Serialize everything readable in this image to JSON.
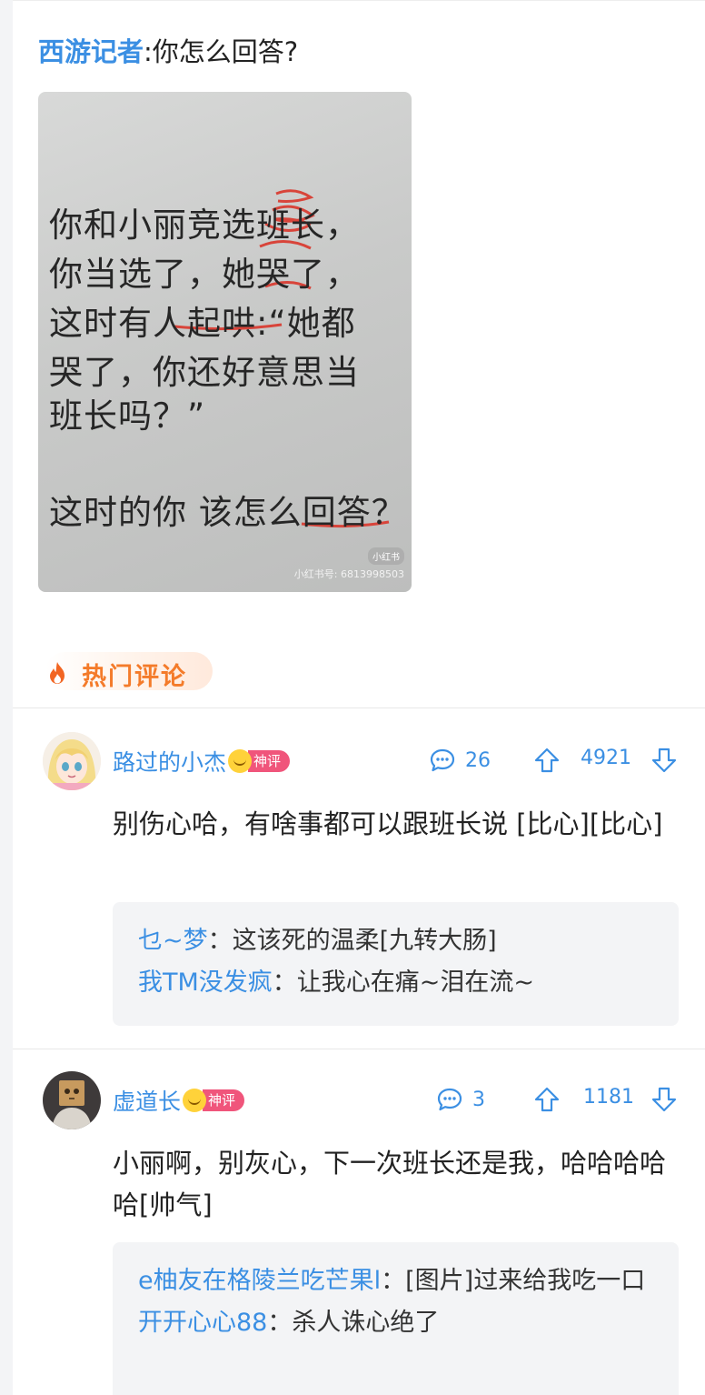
{
  "post": {
    "author": "西游记者",
    "separator": ":",
    "text": "你怎么回答?",
    "image": {
      "lines": [
        "你和小丽竞选班长，",
        "你当选了，她哭了，",
        "这时有人起哄:“她都",
        "哭了，你还好意思当",
        "班长吗？”",
        "这时的你 该怎么回答？"
      ],
      "logo": "小红书",
      "watermark": "小红书号: 6813998503"
    }
  },
  "hot_section": {
    "icon": "flame-icon",
    "label": "热门评论",
    "accent_color": "#f47b2a"
  },
  "comments": [
    {
      "username": "路过的小杰",
      "badge": "神评",
      "reply_count": "26",
      "upvotes": "4921",
      "text": "别伤心哈，有啥事都可以跟班长说 [比心][比心]",
      "replies": [
        {
          "user": "乜~梦",
          "sep": "：",
          "text": "这该死的温柔[九转大肠]"
        },
        {
          "user": "我TM没发疯",
          "sep": "：",
          "text": "让我心在痛~泪在流~"
        }
      ]
    },
    {
      "username": "虚道长",
      "badge": "神评",
      "reply_count": "3",
      "upvotes": "1181",
      "text": "小丽啊，别灰心，下一次班长还是我，哈哈哈哈哈[帅气]",
      "replies": [
        {
          "user": "e柚友在格陵兰吃芒果l",
          "sep": "：",
          "text": "[图片]过来给我吃一口"
        },
        {
          "user": "开开心心88",
          "sep": "：",
          "text": "杀人诛心绝了"
        }
      ]
    }
  ],
  "colors": {
    "link": "#3b8fe3",
    "badge": "#f0557b",
    "reply_bg": "#f3f4f6"
  }
}
